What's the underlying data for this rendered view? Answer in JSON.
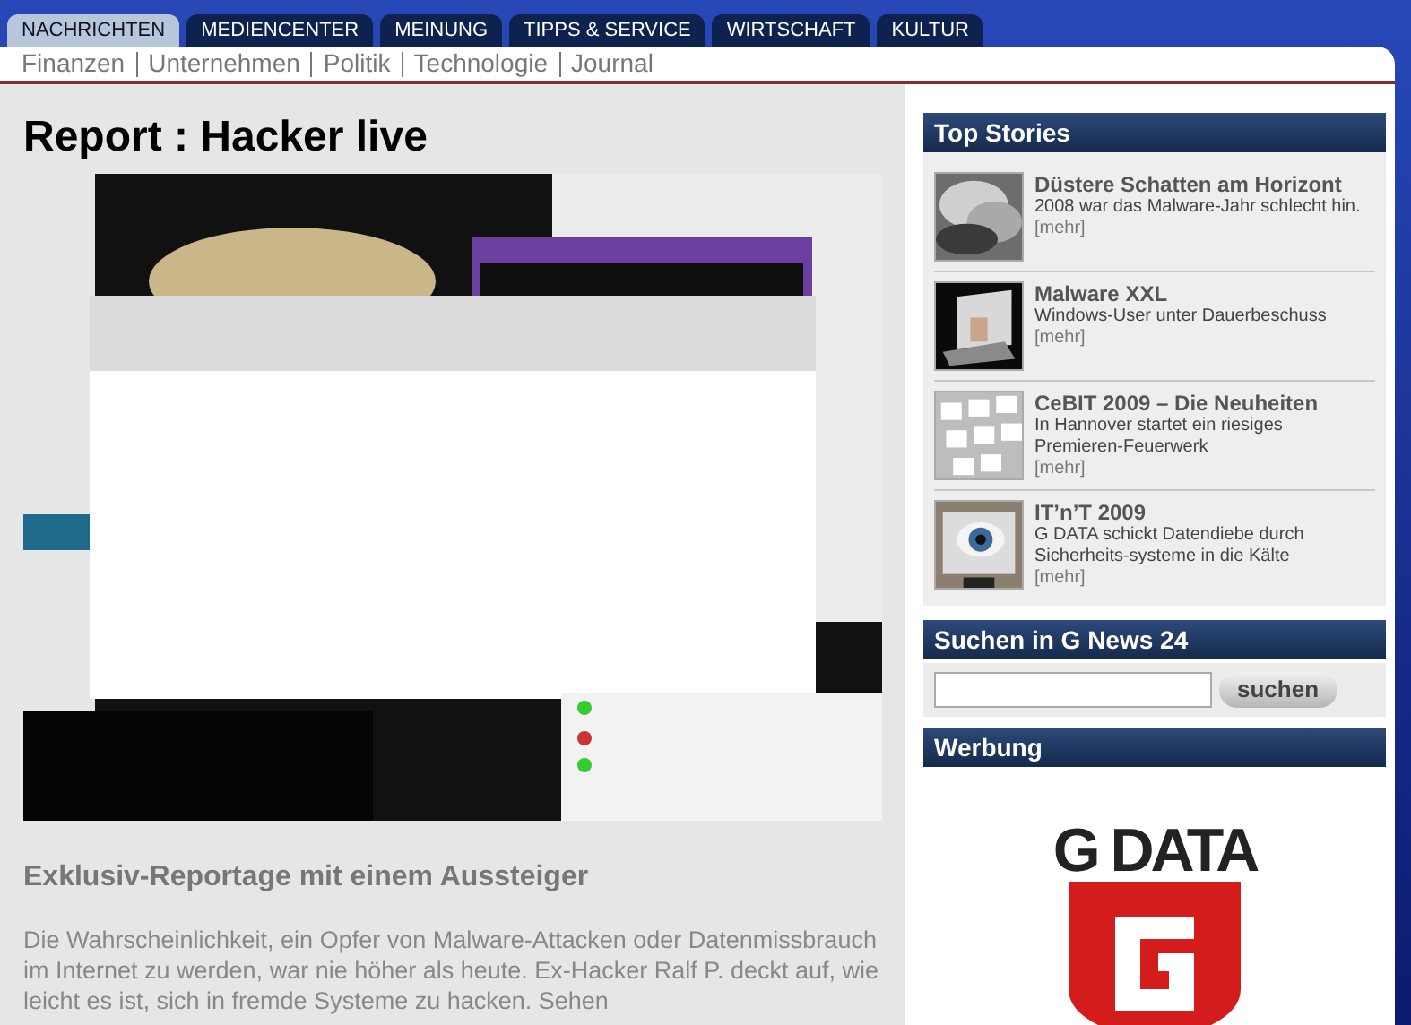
{
  "nav": {
    "tabs": [
      {
        "label": "NACHRICHTEN",
        "selected": true
      },
      {
        "label": "MEDIENCENTER",
        "selected": false
      },
      {
        "label": "MEINUNG",
        "selected": false
      },
      {
        "label": "TIPPS & SERVICE",
        "selected": false
      },
      {
        "label": "WIRTSCHAFT",
        "selected": false
      },
      {
        "label": "KULTUR",
        "selected": false
      }
    ]
  },
  "subnav": {
    "links": [
      "Finanzen",
      "Unternehmen",
      "Politik",
      "Technologie",
      "Journal"
    ]
  },
  "article": {
    "title": "Report : Hacker live",
    "subtitle": "Exklusiv-Reportage mit einem Aussteiger",
    "body": "Die Wahrscheinlichkeit, ein Opfer von Malware-Attacken oder Datenmissbrauch im Internet zu werden, war nie höher als heute. Ex-Hacker Ralf P. deckt auf, wie leicht es ist, sich in fremde Systeme zu hacken. Sehen"
  },
  "sidebar": {
    "top_stories": {
      "title": "Top Stories",
      "items": [
        {
          "kind": "cloud",
          "title": "Düstere Schatten am Horizont",
          "description": "2008 war das Malware-Jahr schlecht hin.",
          "more": "[mehr]"
        },
        {
          "kind": "laptop",
          "title": "Malware XXL",
          "description": "Windows-User unter Dauerbeschuss",
          "more": "[mehr]"
        },
        {
          "kind": "keyboard",
          "title": "CeBIT 2009 – Die Neuheiten",
          "description": "In Hannover startet ein riesiges Premieren-Feuerwerk",
          "more": "[mehr]"
        },
        {
          "kind": "eye",
          "title": "IT’n’T 2009",
          "description": "G DATA schickt Datendiebe durch Sicherheits-systeme in die Kälte",
          "more": "[mehr]"
        }
      ]
    },
    "search": {
      "title": "Suchen in G News 24",
      "button": "suchen"
    },
    "ad": {
      "title": "Werbung",
      "logo_text": "G DATA"
    }
  }
}
